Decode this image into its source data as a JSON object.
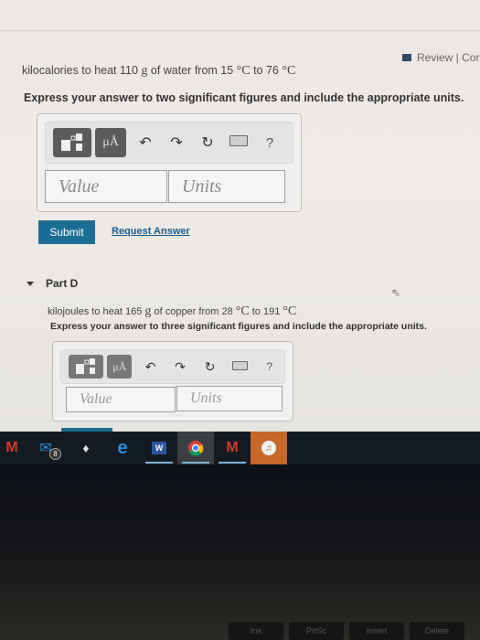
{
  "header": {
    "review_label": "Review | Cor"
  },
  "part_c": {
    "question_prefix": "kilocalories to heat 110 ",
    "mass_unit": "g",
    "question_mid": " of water from 15 ",
    "temp_unit_1": "°C",
    "question_to": " to 76 ",
    "temp_unit_2": "°C",
    "instruction": "Express your answer to two significant figures and include the appropriate units.",
    "value_placeholder": "Value",
    "units_placeholder": "Units",
    "submit_label": "Submit",
    "request_answer_label": "Request Answer"
  },
  "toolbar": {
    "templates_icon": "templates-icon",
    "units_label": "μÅ",
    "undo_icon": "↶",
    "redo_icon": "↷",
    "reset_icon": "↻",
    "keyboard_icon": "keyboard-icon",
    "help_label": "?"
  },
  "part_d": {
    "title": "Part D",
    "question_prefix": "kilojoules to heat 165 ",
    "mass_unit": "g",
    "question_mid": " of copper from 28 ",
    "temp_unit_1": "°C",
    "question_to": " to 191 ",
    "temp_unit_2": "°C",
    "instruction": "Express your answer to three significant figures and include the appropriate units.",
    "value_placeholder": "Value",
    "units_placeholder": "Units"
  },
  "taskbar": {
    "apps": [
      {
        "name": "mcafee",
        "glyph": "M",
        "color": "#d23b2a"
      },
      {
        "name": "mail",
        "glyph": "✉",
        "color": "#2a8ad6",
        "badge": "8"
      },
      {
        "name": "app-ghost",
        "glyph": "♦",
        "color": "#e0e0e0"
      },
      {
        "name": "edge",
        "glyph": "e",
        "color": "#2a8ad6"
      },
      {
        "name": "word",
        "glyph": "W",
        "color": "#2b579a"
      },
      {
        "name": "chrome",
        "glyph": "●",
        "color": "#e8b21a"
      },
      {
        "name": "mcafee-2",
        "glyph": "M",
        "color": "#d23b2a"
      },
      {
        "name": "itunes",
        "glyph": "♫",
        "color": "#ffffff"
      }
    ]
  },
  "keyboard": {
    "keys": [
      "Ins",
      "PrtSc",
      "Insert",
      "Delete"
    ]
  }
}
